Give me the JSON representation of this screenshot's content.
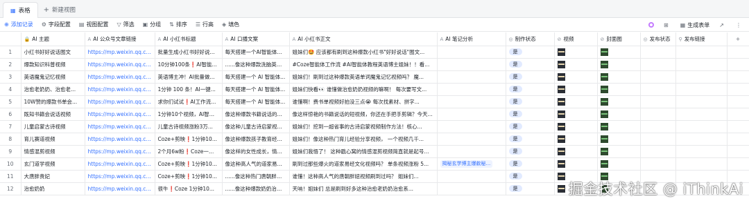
{
  "tabs": [
    {
      "label": "表格",
      "icon": "table-icon"
    },
    {
      "label": "新建视图",
      "icon": "plus-icon"
    }
  ],
  "toolbar": {
    "add_record": "添加记录",
    "field_config": "字段配置",
    "view_config": "视图配置",
    "filter": "筛选",
    "group": "分组",
    "sort": "排序",
    "row_height": "行高",
    "fill": "填色",
    "generate_form": "生成表单"
  },
  "columns": [
    {
      "label": "",
      "icon": ""
    },
    {
      "label": "AI 主题",
      "icon": "lock-icon"
    },
    {
      "label": "AI 公众号文章链接",
      "icon": "ai-icon"
    },
    {
      "label": "AI 小红书标题",
      "icon": "ai-icon"
    },
    {
      "label": "AI 口播文案",
      "icon": "ai-icon"
    },
    {
      "label": "AI 小红书正文",
      "icon": "ai-icon"
    },
    {
      "label": "AI 笔记分析",
      "icon": "ai-icon"
    },
    {
      "label": "制作状态",
      "icon": "status-icon"
    },
    {
      "label": "视频",
      "icon": "attachment-icon"
    },
    {
      "label": "封面图",
      "icon": "attachment-icon"
    },
    {
      "label": "发布状态",
      "icon": "status-icon"
    },
    {
      "label": "发布链接",
      "icon": "link-icon"
    },
    {
      "label": "+",
      "icon": ""
    }
  ],
  "rows": [
    {
      "num": "1",
      "theme": "小红书好好说话图文",
      "link": "https://mp.weixin.qq.co...",
      "title": "批量生成小红书好好说...",
      "script": "每天搭建一个AI智能体...",
      "body": "姐妹们🤩 应该都有刷到这种爆款小红书\"好好说话\"图文...",
      "analysis": "",
      "status": "是",
      "video": true,
      "cover": true
    },
    {
      "num": "2",
      "theme": "爆款知识科普视频",
      "link": "https://mp.weixin.qq.co...",
      "title": "10分钟100条❗AI智能...",
      "script": "......像这种爆款洗脑英语...",
      "body": "#Coze智能体工作流 #AI智能体教程英语博主姐妹！！看...",
      "analysis": "",
      "status": "是",
      "video": true,
      "cover": true
    },
    {
      "num": "3",
      "theme": "英语魔鬼记忆视频",
      "link": "https://mp.weixin.qq.co...",
      "title": "英语博主冲！AI批量做...",
      "script": "每天搭建一个 AI 智能体...",
      "body": "姐妹们！刷到过这种爆款英语单词魔鬼记忆视频吗？ 魔...",
      "analysis": "",
      "status": "是",
      "video": true,
      "cover": true
    },
    {
      "num": "4",
      "theme": "治愈老奶奶、治愈老...",
      "link": "https://mp.weixin.qq.co...",
      "title": "1分钟 100 条！AI一键...",
      "script": "每天搭建一个 AI 智能体...",
      "body": "姐妹们快看👀 谁懂做治愈奶奶视频的嘛啊！ 每次要写文...",
      "analysis": "",
      "status": "是",
      "video": true,
      "cover": true
    },
    {
      "num": "5",
      "theme": "10W赞的爆款书单会...",
      "link": "https://mp.weixin.qq.co...",
      "title": "求你们试试❗AI工作流...",
      "script": "每天搭建一个 AI 智能体...",
      "body": "谁懂啊！费书单视频好拍没三点😭 每次找素材、拼字...",
      "analysis": "",
      "status": "是",
      "video": true,
      "cover": true
    },
    {
      "num": "6",
      "theme": "既知书籍会说话视频",
      "link": "https://mp.weixin.qq.co...",
      "title": "1分钟10个视频，AI智能...",
      "script": "像这种爆款书籍说话的...",
      "body": "像这样惊艳的书籍说话的短视频，你还在手把手剪辑？今天...",
      "analysis": "",
      "status": "是",
      "video": true,
      "cover": true
    },
    {
      "num": "7",
      "theme": "儿童启蒙古诗视频",
      "link": "https://mp.weixin.qq.co...",
      "title": "儿童古诗视频涨粉3万...",
      "script": "像这种儿童古诗启蒙视...",
      "body": "姐妹们！挖到一超省事的古诗启蒙视频制作方法！核心...",
      "analysis": "",
      "status": "是",
      "video": true,
      "cover": true
    },
    {
      "num": "8",
      "theme": "育儿赛道视频",
      "link": "https://mp.weixin.qq.co...",
      "title": "Coze+剪映❗1分钟10...",
      "script": "像这种爆款孩子教育经...",
      "body": "姐妹们！像这种热门育儿经验分享视频， 一个视频几千...",
      "analysis": "",
      "status": "是",
      "video": true,
      "cover": true
    },
    {
      "num": "9",
      "theme": "情感混剪视频",
      "link": "https://mp.weixin.qq.co...",
      "title": "2个月6w粉❗Coze一分...",
      "script": "像这样的女性成长，情...",
      "body": "姐妹们我悟了！ 这种戳心窝的情感混剪视频简直就是起号...",
      "analysis": "",
      "status": "是",
      "video": true,
      "cover": true
    },
    {
      "num": "10",
      "theme": "玄门道学视频",
      "link": "https://mp.weixin.qq.co...",
      "title": "Coze+剪映❗1分钟10...",
      "script": "像这种高人气的道家易...",
      "body": "刷到过那些爆火的道家易经文化视频吗？ 单条视频涨粉 5...",
      "analysis": "揭秘玄学博主爆款秘...",
      "status": "是",
      "video": true,
      "cover": true
    },
    {
      "num": "11",
      "theme": "大唐胖贵妃",
      "link": "https://mp.weixin.qq.co...",
      "title": "Coze+剪映❗1分钟10...",
      "script": "......像这种热门唐朝胖妞...",
      "body": "谁懂！这种高人气的唐朝胖妞视频刷到过吗？ 姐妹们...",
      "analysis": "",
      "status": "是",
      "video": true,
      "cover": true
    },
    {
      "num": "12",
      "theme": "治愈奶奶",
      "link": "https://mp.weixin.qq.co...",
      "title": "很牛❗Coze 1分钟10...",
      "script": "......像这种爆款奶奶治愈系...",
      "body": "天呐！姐妹们 总是刷到好多这种治愈老奶奶治愈系...",
      "analysis": "",
      "status": "是",
      "video": true,
      "cover": true
    }
  ],
  "watermark": "掘金技术社区 @ iThinkAi"
}
